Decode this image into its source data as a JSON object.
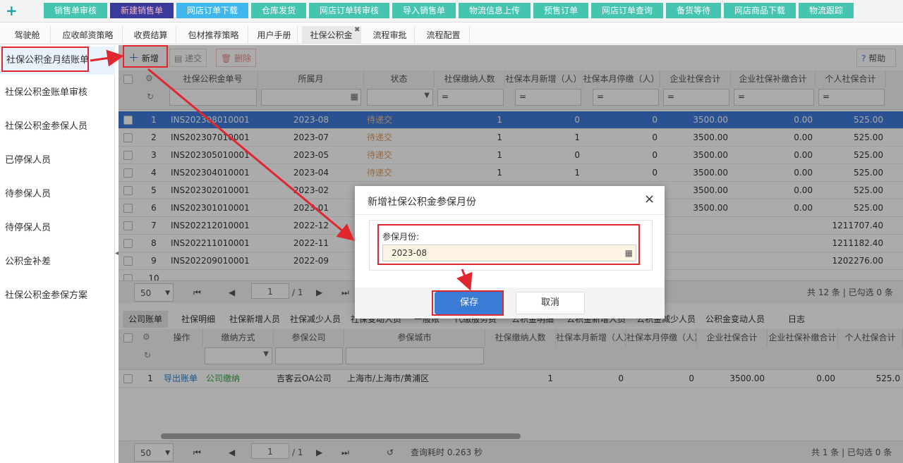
{
  "quickbar": [
    "销售单审核",
    "新建销售单",
    "网店订单下载",
    "仓库发货",
    "网店订单转审核",
    "导入销售单",
    "物流信息上传",
    "预售订单",
    "网店订单查询",
    "备货等待",
    "网店商品下载",
    "物流跟踪"
  ],
  "tabs": [
    "驾驶舱",
    "应收邮资策略",
    "收费结算",
    "包材推荐策略",
    "用户手册",
    "社保公积金",
    "流程审批",
    "流程配置"
  ],
  "sidebar": [
    "社保公积金月结账单",
    "社保公积金账单审核",
    "社保公积金参保人员",
    "已停保人员",
    "待参保人员",
    "待停保人员",
    "公积金补差",
    "社保公积金参保方案"
  ],
  "toolbar": {
    "add": "新增",
    "submit": "递交",
    "delete": "删除",
    "help": "帮助"
  },
  "grid": {
    "headers": [
      "社保公积金单号",
      "所属月",
      "状态",
      "社保缴纳人数",
      "社保本月新增（人）",
      "社保本月停缴（人）",
      "企业社保合计",
      "企业社保补缴合计",
      "个人社保合计"
    ],
    "rows": [
      {
        "n": "1",
        "id": "INS202308010001",
        "m": "2023-08",
        "s": "待递交",
        "c": "1",
        "a": "0",
        "p": "0",
        "e": "3500.00",
        "b": "0.00",
        "i": "525.00"
      },
      {
        "n": "2",
        "id": "INS202307010001",
        "m": "2023-07",
        "s": "待递交",
        "c": "1",
        "a": "1",
        "p": "0",
        "e": "3500.00",
        "b": "0.00",
        "i": "525.00"
      },
      {
        "n": "3",
        "id": "INS202305010001",
        "m": "2023-05",
        "s": "待递交",
        "c": "1",
        "a": "0",
        "p": "0",
        "e": "3500.00",
        "b": "0.00",
        "i": "525.00"
      },
      {
        "n": "4",
        "id": "INS202304010001",
        "m": "2023-04",
        "s": "待递交",
        "c": "1",
        "a": "1",
        "p": "0",
        "e": "3500.00",
        "b": "0.00",
        "i": "525.00"
      },
      {
        "n": "5",
        "id": "INS202302010001",
        "m": "2023-02",
        "s": "",
        "c": "",
        "a": "",
        "p": "",
        "e": "3500.00",
        "b": "0.00",
        "i": "525.00"
      },
      {
        "n": "6",
        "id": "INS202301010001",
        "m": "2023-01",
        "s": "",
        "c": "",
        "a": "",
        "p": "",
        "e": "3500.00",
        "b": "0.00",
        "i": "525.00"
      },
      {
        "n": "7",
        "id": "INS202212010001",
        "m": "2022-12",
        "s": "",
        "c": "",
        "a": "",
        "p": "",
        "e": "",
        "b": "",
        "i": "1211707.40"
      },
      {
        "n": "8",
        "id": "INS202211010001",
        "m": "2022-11",
        "s": "",
        "c": "",
        "a": "",
        "p": "",
        "e": "",
        "b": "",
        "i": "1211182.40"
      },
      {
        "n": "9",
        "id": "INS202209010001",
        "m": "2022-09",
        "s": "",
        "c": "",
        "a": "",
        "p": "",
        "e": "",
        "b": "",
        "i": "1202276.00"
      },
      {
        "n": "10",
        "id": "",
        "m": "",
        "s": "",
        "c": "",
        "a": "",
        "p": "",
        "e": "",
        "b": "",
        "i": ""
      }
    ],
    "pagesize": "50",
    "page": "1",
    "pages": "/ 1",
    "total": "共 12 条 | 已勾选 0 条"
  },
  "lower": {
    "tabs": [
      "公司账单",
      "社保明细",
      "社保新增人员",
      "社保减少人员",
      "社保变动人员",
      "一般账",
      "代缴服务费",
      "公积金明细",
      "公积金新增人员",
      "公积金减少人员",
      "公积金变动人员",
      "日志"
    ],
    "headers": [
      "操作",
      "缴纳方式",
      "参保公司",
      "参保城市",
      "社保缴纳人数",
      "社保本月新增（人）",
      "社保本月停缴（人）",
      "企业社保合计",
      "企业社保补缴合计",
      "个人社保合计"
    ],
    "row": {
      "n": "1",
      "op": "导出账单",
      "pay": "公司缴纳",
      "company": "吉客云OA公司",
      "city": "上海市/上海市/黄浦区",
      "c": "1",
      "a": "0",
      "p": "0",
      "e": "3500.00",
      "b": "0.00",
      "i": "525.0"
    },
    "pagesize": "50",
    "page": "1",
    "pages": "/ 1",
    "elapsed": "查询耗时 0.263 秒",
    "total": "共 1 条 | 已勾选 0 条"
  },
  "dialog": {
    "title": "新增社保公积金参保月份",
    "field_label": "参保月份:",
    "field_value": "2023-08",
    "save": "保存",
    "cancel": "取消"
  }
}
